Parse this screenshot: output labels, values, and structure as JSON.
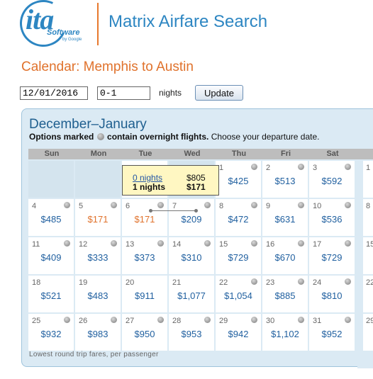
{
  "header": {
    "logo_text": "ita",
    "logo_software": "Software",
    "logo_by": "by Google",
    "app_title": "Matrix Airfare Search"
  },
  "calendar_heading": "Calendar: Memphis to Austin",
  "controls": {
    "date_value": "12/01/2016",
    "nights_value": "0-1",
    "nights_label": "nights",
    "update_label": "Update"
  },
  "panel": {
    "month_title": "December–January",
    "legend_bold_1": "Options marked",
    "legend_bold_2": "contain overnight flights.",
    "legend_rest": " Choose your departure date.",
    "weekdays": [
      "Sun",
      "Mon",
      "Tue",
      "Wed",
      "Thu",
      "Fri",
      "Sat"
    ],
    "footnote": "Lowest round trip fares, per passenger"
  },
  "weeks": [
    [
      null,
      null,
      {
        "day": "",
        "fare": ""
      },
      null,
      {
        "day": "1",
        "fare": "$425",
        "overnight": true
      },
      {
        "day": "2",
        "fare": "$513",
        "overnight": true
      },
      {
        "day": "3",
        "fare": "$592",
        "overnight": true
      }
    ],
    [
      {
        "day": "4",
        "fare": "$485",
        "overnight": true
      },
      {
        "day": "5",
        "fare": "$171",
        "overnight": true,
        "highlight": true
      },
      {
        "day": "6",
        "fare": "$171",
        "overnight": true,
        "highlight": true
      },
      {
        "day": "7",
        "fare": "$209",
        "overnight": true
      },
      {
        "day": "8",
        "fare": "$472",
        "overnight": true
      },
      {
        "day": "9",
        "fare": "$631",
        "overnight": true
      },
      {
        "day": "10",
        "fare": "$536",
        "overnight": true
      }
    ],
    [
      {
        "day": "11",
        "fare": "$409",
        "overnight": true
      },
      {
        "day": "12",
        "fare": "$333",
        "overnight": true
      },
      {
        "day": "13",
        "fare": "$373",
        "overnight": true
      },
      {
        "day": "14",
        "fare": "$310",
        "overnight": true
      },
      {
        "day": "15",
        "fare": "$729",
        "overnight": true
      },
      {
        "day": "16",
        "fare": "$670",
        "overnight": true
      },
      {
        "day": "17",
        "fare": "$729",
        "overnight": true
      }
    ],
    [
      {
        "day": "18",
        "fare": "$521",
        "overnight": false
      },
      {
        "day": "19",
        "fare": "$483",
        "overnight": false
      },
      {
        "day": "20",
        "fare": "$911",
        "overnight": false
      },
      {
        "day": "21",
        "fare": "$1,077",
        "overnight": false
      },
      {
        "day": "22",
        "fare": "$1,054",
        "overnight": true
      },
      {
        "day": "23",
        "fare": "$885",
        "overnight": true
      },
      {
        "day": "24",
        "fare": "$810",
        "overnight": true
      }
    ],
    [
      {
        "day": "25",
        "fare": "$932",
        "overnight": true
      },
      {
        "day": "26",
        "fare": "$983",
        "overnight": true
      },
      {
        "day": "27",
        "fare": "$950",
        "overnight": true
      },
      {
        "day": "28",
        "fare": "$953",
        "overnight": true
      },
      {
        "day": "29",
        "fare": "$942",
        "overnight": true
      },
      {
        "day": "30",
        "fare": "$1,102",
        "overnight": true
      },
      {
        "day": "31",
        "fare": "$952",
        "overnight": true
      }
    ]
  ],
  "next_month_days": [
    "1",
    "8",
    "15",
    "22",
    "29"
  ],
  "tooltip": {
    "row1_label": "0 nights",
    "row1_price": "$805",
    "row2_label": "1 nights",
    "row2_price": "$171"
  }
}
